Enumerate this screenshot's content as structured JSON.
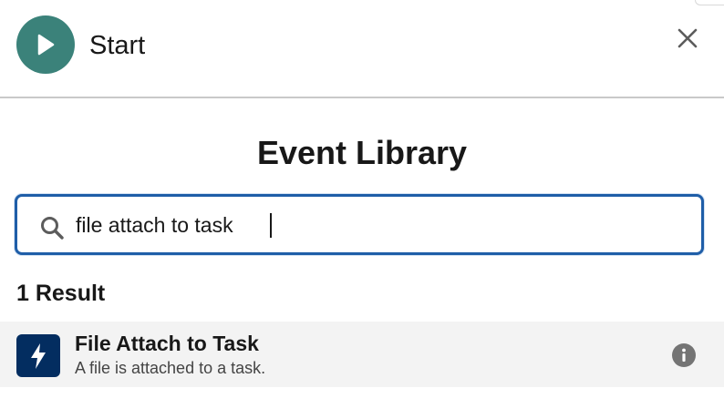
{
  "header": {
    "title": "Start",
    "start_icon": "play-icon",
    "close_icon": "close-icon",
    "accent_color": "#3b827a"
  },
  "library": {
    "title": "Event Library"
  },
  "search": {
    "value": "file attach to task",
    "icon": "search-icon",
    "focus_color": "#1f5ea8"
  },
  "results": {
    "count_label": "1 Result",
    "items": [
      {
        "name": "File Attach to Task",
        "description": "A file is attached to a task.",
        "icon": "lightning-bolt-icon",
        "icon_color": "#032d60",
        "info_icon": "info-icon"
      }
    ]
  }
}
